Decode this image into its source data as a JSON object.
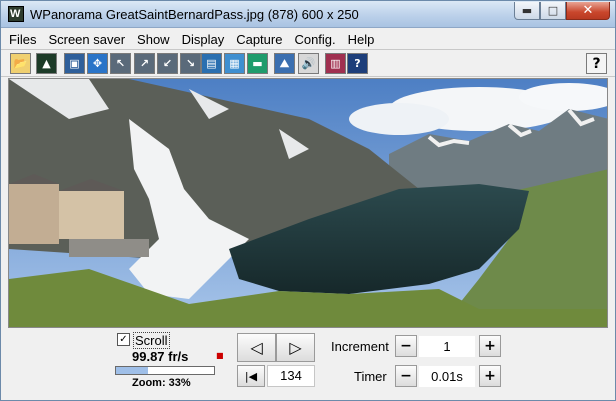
{
  "window": {
    "title": "WPanorama  GreatSaintBernardPass.jpg   (878) 600 x 250",
    "icon": "wpanorama-app-icon",
    "buttons": {
      "minimize": "▬",
      "maximize": "□",
      "close": "✕"
    }
  },
  "menu": [
    "Files",
    "Screen saver",
    "Show",
    "Display",
    "Capture",
    "Config.",
    "Help"
  ],
  "toolbar": {
    "buttons": [
      {
        "name": "open-file-icon",
        "glyph": "📂",
        "color": "#f0d070"
      },
      {
        "name": "landscape-image-icon",
        "glyph": "▲",
        "color": "#1d3b28"
      },
      {
        "name": "fit-frame-icon",
        "glyph": "▣",
        "color": "#2f5f9a"
      },
      {
        "name": "move-arrows-icon",
        "glyph": "✥",
        "color": "#2a74c8"
      },
      {
        "name": "shrink-arrows-icon",
        "glyph": "↖",
        "color": "#5a6a7a"
      },
      {
        "name": "arrow-up-right-icon",
        "glyph": "↗",
        "color": "#5a6a7a"
      },
      {
        "name": "arrow-down-left-icon",
        "glyph": "↙",
        "color": "#5a6a7a"
      },
      {
        "name": "arrow-down-right-icon",
        "glyph": "↘",
        "color": "#5a6a7a"
      },
      {
        "name": "panorama-strip-icon",
        "glyph": "▤",
        "color": "#2a6fb0"
      },
      {
        "name": "gradient-strip-icon",
        "glyph": "▦",
        "color": "#3f8fd0"
      },
      {
        "name": "flat-strip-icon",
        "glyph": "▬",
        "color": "#1f9c6c"
      },
      {
        "name": "mountain-peak-icon",
        "glyph": "⛰",
        "color": "#3b6fb0"
      },
      {
        "name": "sound-speaker-icon",
        "glyph": "🔊",
        "color": "#d8d8d8"
      },
      {
        "name": "book-icon",
        "glyph": "▥",
        "color": "#a03050"
      },
      {
        "name": "help-topics-icon",
        "glyph": "?",
        "color": "#1d3e7a"
      },
      {
        "name": "context-help-icon",
        "glyph": "?",
        "color": "#f4f4f4"
      }
    ]
  },
  "controls": {
    "scroll_checked": "✓",
    "scroll_label": "Scroll",
    "fps": "99.87 fr/s",
    "zoom": "Zoom: 33%",
    "zoom_fraction": 0.33,
    "prev_glyph": "◁",
    "next_glyph": "▷",
    "first_glyph": "|◀",
    "position": "134",
    "increment_label": "Increment",
    "increment_value": "1",
    "timer_label": "Timer",
    "timer_value": "0.01s",
    "minus": "−",
    "plus": "+"
  }
}
